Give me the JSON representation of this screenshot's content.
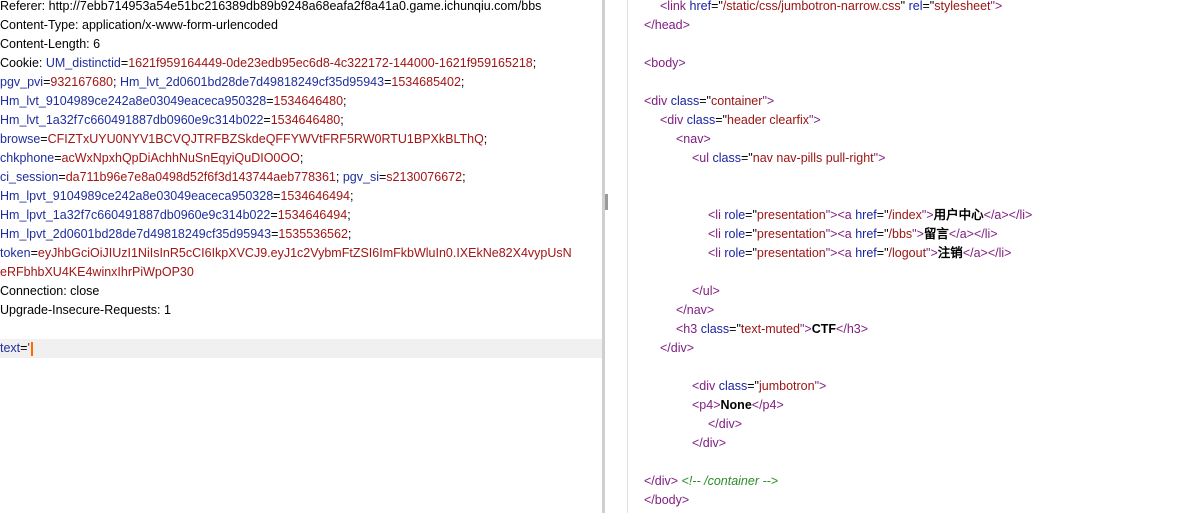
{
  "request": {
    "lines": [
      {
        "parts": [
          {
            "text": "Referer: http://7ebb714953a54e51bc216389db89b9248a68eafa2f8a41a0.game.ichunqiu.com/bbs",
            "c": ""
          }
        ]
      },
      {
        "parts": [
          {
            "text": "Content-Type: application/x-www-form-urlencoded",
            "c": ""
          }
        ]
      },
      {
        "parts": [
          {
            "text": "Content-Length: 6",
            "c": ""
          }
        ]
      },
      {
        "parts": [
          {
            "text": "Cookie: ",
            "c": ""
          },
          {
            "text": "UM_distinctid",
            "c": "k"
          },
          {
            "text": "=",
            "c": ""
          },
          {
            "text": "1621f959164449-0de23edb95ec6d8-4c322172-144000-1621f959165218",
            "c": "v"
          },
          {
            "text": ";",
            "c": ""
          }
        ]
      },
      {
        "parts": [
          {
            "text": "pgv_pvi",
            "c": "k"
          },
          {
            "text": "=",
            "c": ""
          },
          {
            "text": "932167680",
            "c": "v"
          },
          {
            "text": "; ",
            "c": ""
          },
          {
            "text": "Hm_lvt_2d0601bd28de7d49818249cf35d95943",
            "c": "k"
          },
          {
            "text": "=",
            "c": ""
          },
          {
            "text": "1534685402",
            "c": "v"
          },
          {
            "text": ";",
            "c": ""
          }
        ]
      },
      {
        "parts": [
          {
            "text": "Hm_lvt_9104989ce242a8e03049eaceca950328",
            "c": "k"
          },
          {
            "text": "=",
            "c": ""
          },
          {
            "text": "1534646480",
            "c": "v"
          },
          {
            "text": ";",
            "c": ""
          }
        ]
      },
      {
        "parts": [
          {
            "text": "Hm_lvt_1a32f7c660491887db0960e9c314b022",
            "c": "k"
          },
          {
            "text": "=",
            "c": ""
          },
          {
            "text": "1534646480",
            "c": "v"
          },
          {
            "text": ";",
            "c": ""
          }
        ]
      },
      {
        "parts": [
          {
            "text": "browse",
            "c": "k"
          },
          {
            "text": "=",
            "c": ""
          },
          {
            "text": "CFIZTxUYU0NYV1BCVQJTRFBZSkdeQFFYWVtFRF5RW0RTU1BPXkBLThQ",
            "c": "v"
          },
          {
            "text": ";",
            "c": ""
          }
        ]
      },
      {
        "parts": [
          {
            "text": "chkphone",
            "c": "k"
          },
          {
            "text": "=",
            "c": ""
          },
          {
            "text": "acWxNpxhQpDiAchhNuSnEqyiQuDIO0OO",
            "c": "v"
          },
          {
            "text": ";",
            "c": ""
          }
        ]
      },
      {
        "parts": [
          {
            "text": "ci_session",
            "c": "k"
          },
          {
            "text": "=",
            "c": ""
          },
          {
            "text": "da711b96e7e8a0498d52f6f3d143744aeb778361",
            "c": "v"
          },
          {
            "text": "; ",
            "c": ""
          },
          {
            "text": "pgv_si",
            "c": "k"
          },
          {
            "text": "=",
            "c": ""
          },
          {
            "text": "s2130076672",
            "c": "v"
          },
          {
            "text": ";",
            "c": ""
          }
        ]
      },
      {
        "parts": [
          {
            "text": "Hm_lpvt_9104989ce242a8e03049eaceca950328",
            "c": "k"
          },
          {
            "text": "=",
            "c": ""
          },
          {
            "text": "1534646494",
            "c": "v"
          },
          {
            "text": ";",
            "c": ""
          }
        ]
      },
      {
        "parts": [
          {
            "text": "Hm_lpvt_1a32f7c660491887db0960e9c314b022",
            "c": "k"
          },
          {
            "text": "=",
            "c": ""
          },
          {
            "text": "1534646494",
            "c": "v"
          },
          {
            "text": ";",
            "c": ""
          }
        ]
      },
      {
        "parts": [
          {
            "text": "Hm_lpvt_2d0601bd28de7d49818249cf35d95943",
            "c": "k"
          },
          {
            "text": "=",
            "c": ""
          },
          {
            "text": "1535536562",
            "c": "v"
          },
          {
            "text": ";",
            "c": ""
          }
        ]
      },
      {
        "parts": [
          {
            "text": "token",
            "c": "k"
          },
          {
            "text": "=",
            "c": ""
          },
          {
            "text": "eyJhbGciOiJIUzI1NiIsInR5cCI6IkpXVCJ9.eyJ1c2VybmFtZSI6ImFkbWluIn0.IXEkNe82X4vypUsN",
            "c": "v"
          }
        ]
      },
      {
        "parts": [
          {
            "text": "eRFbhbXU4KE4winxIhrPiWpOP30",
            "c": "v"
          }
        ]
      },
      {
        "parts": [
          {
            "text": "Connection: close",
            "c": ""
          }
        ]
      },
      {
        "parts": [
          {
            "text": "Upgrade-Insecure-Requests: 1",
            "c": ""
          }
        ]
      },
      {
        "parts": [
          {
            "text": "",
            "c": ""
          }
        ]
      },
      {
        "parts": [
          {
            "text": "text",
            "c": "k"
          },
          {
            "text": "=",
            "c": ""
          },
          {
            "text": "'",
            "c": "v"
          }
        ],
        "active": true,
        "cursor": true
      }
    ]
  },
  "response": {
    "lines": [
      {
        "indent": 1,
        "parts": [
          {
            "text": "<link ",
            "c": "t"
          },
          {
            "text": "href",
            "c": "a"
          },
          {
            "text": "=\"",
            "c": ""
          },
          {
            "text": "/static/css/jumbotron-narrow.css",
            "c": "s"
          },
          {
            "text": "\" ",
            "c": ""
          },
          {
            "text": "rel",
            "c": "a"
          },
          {
            "text": "=\"",
            "c": ""
          },
          {
            "text": "stylesheet",
            "c": "s"
          },
          {
            "text": "\">",
            "c": "t"
          }
        ]
      },
      {
        "indent": 0,
        "parts": [
          {
            "text": "</head>",
            "c": "t"
          }
        ]
      },
      {
        "indent": 0,
        "parts": []
      },
      {
        "indent": 0,
        "parts": [
          {
            "text": "<body>",
            "c": "t"
          }
        ]
      },
      {
        "indent": 0,
        "parts": []
      },
      {
        "indent": 0,
        "parts": [
          {
            "text": "<div ",
            "c": "t"
          },
          {
            "text": "class",
            "c": "a"
          },
          {
            "text": "=\"",
            "c": ""
          },
          {
            "text": "container",
            "c": "s"
          },
          {
            "text": "\">",
            "c": "t"
          }
        ]
      },
      {
        "indent": 1,
        "parts": [
          {
            "text": "<div ",
            "c": "t"
          },
          {
            "text": "class",
            "c": "a"
          },
          {
            "text": "=\"",
            "c": ""
          },
          {
            "text": "header clearfix",
            "c": "s"
          },
          {
            "text": "\">",
            "c": "t"
          }
        ]
      },
      {
        "indent": 2,
        "parts": [
          {
            "text": "<nav>",
            "c": "t"
          }
        ]
      },
      {
        "indent": 3,
        "parts": [
          {
            "text": "<ul ",
            "c": "t"
          },
          {
            "text": "class",
            "c": "a"
          },
          {
            "text": "=\"",
            "c": ""
          },
          {
            "text": "nav nav-pills pull-right",
            "c": "s"
          },
          {
            "text": "\">",
            "c": "t"
          }
        ]
      },
      {
        "indent": 0,
        "parts": []
      },
      {
        "indent": 0,
        "parts": []
      },
      {
        "indent": 4,
        "parts": [
          {
            "text": "<li ",
            "c": "t"
          },
          {
            "text": "role",
            "c": "a"
          },
          {
            "text": "=\"",
            "c": ""
          },
          {
            "text": "presentation",
            "c": "s"
          },
          {
            "text": "\">",
            "c": "t"
          },
          {
            "text": "<a ",
            "c": "t"
          },
          {
            "text": "href",
            "c": "a"
          },
          {
            "text": "=\"",
            "c": ""
          },
          {
            "text": "/index",
            "c": "s"
          },
          {
            "text": "\">",
            "c": "t"
          },
          {
            "text": "用户中心",
            "c": "bold"
          },
          {
            "text": "</a>",
            "c": "t"
          },
          {
            "text": "</li>",
            "c": "t"
          }
        ]
      },
      {
        "indent": 4,
        "parts": [
          {
            "text": "<li ",
            "c": "t"
          },
          {
            "text": "role",
            "c": "a"
          },
          {
            "text": "=\"",
            "c": ""
          },
          {
            "text": "presentation",
            "c": "s"
          },
          {
            "text": "\">",
            "c": "t"
          },
          {
            "text": "<a ",
            "c": "t"
          },
          {
            "text": "href",
            "c": "a"
          },
          {
            "text": "=\"",
            "c": ""
          },
          {
            "text": "/bbs",
            "c": "s"
          },
          {
            "text": "\">",
            "c": "t"
          },
          {
            "text": "留言",
            "c": "bold"
          },
          {
            "text": "</a>",
            "c": "t"
          },
          {
            "text": "</li>",
            "c": "t"
          }
        ]
      },
      {
        "indent": 4,
        "parts": [
          {
            "text": "<li ",
            "c": "t"
          },
          {
            "text": "role",
            "c": "a"
          },
          {
            "text": "=\"",
            "c": ""
          },
          {
            "text": "presentation",
            "c": "s"
          },
          {
            "text": "\">",
            "c": "t"
          },
          {
            "text": "<a ",
            "c": "t"
          },
          {
            "text": "href",
            "c": "a"
          },
          {
            "text": "=\"",
            "c": ""
          },
          {
            "text": "/logout",
            "c": "s"
          },
          {
            "text": "\">",
            "c": "t"
          },
          {
            "text": "注销",
            "c": "bold"
          },
          {
            "text": "</a>",
            "c": "t"
          },
          {
            "text": "</li>",
            "c": "t"
          }
        ]
      },
      {
        "indent": 0,
        "parts": []
      },
      {
        "indent": 3,
        "parts": [
          {
            "text": "</ul>",
            "c": "t"
          }
        ]
      },
      {
        "indent": 2,
        "parts": [
          {
            "text": "</nav>",
            "c": "t"
          }
        ]
      },
      {
        "indent": 2,
        "parts": [
          {
            "text": "<h3 ",
            "c": "t"
          },
          {
            "text": "class",
            "c": "a"
          },
          {
            "text": "=\"",
            "c": ""
          },
          {
            "text": "text-muted",
            "c": "s"
          },
          {
            "text": "\">",
            "c": "t"
          },
          {
            "text": "CTF",
            "c": "bold"
          },
          {
            "text": "</h3>",
            "c": "t"
          }
        ]
      },
      {
        "indent": 1,
        "parts": [
          {
            "text": "</div>",
            "c": "t"
          }
        ]
      },
      {
        "indent": 0,
        "parts": []
      },
      {
        "indent": 3,
        "parts": [
          {
            "text": "<div ",
            "c": "t"
          },
          {
            "text": "class",
            "c": "a"
          },
          {
            "text": "=\"",
            "c": ""
          },
          {
            "text": "jumbotron",
            "c": "s"
          },
          {
            "text": "\">",
            "c": "t"
          }
        ]
      },
      {
        "indent": 3,
        "parts": [
          {
            "text": "<p4>",
            "c": "t"
          },
          {
            "text": "None",
            "c": "bold"
          },
          {
            "text": "</p4>",
            "c": "t"
          }
        ]
      },
      {
        "indent": 4,
        "parts": [
          {
            "text": "</div>",
            "c": "t"
          }
        ]
      },
      {
        "indent": 3,
        "parts": [
          {
            "text": "</div>",
            "c": "t"
          }
        ]
      },
      {
        "indent": 0,
        "parts": []
      },
      {
        "indent": 0,
        "parts": [
          {
            "text": "</div> ",
            "c": "t"
          },
          {
            "text": "<!-- /container -->",
            "c": "cm"
          }
        ]
      },
      {
        "indent": 0,
        "parts": [
          {
            "text": "</body>",
            "c": "t"
          }
        ]
      }
    ]
  },
  "colors": {
    "header_key": "#1f2e9f",
    "header_value": "#a31515",
    "tag": "#801e80",
    "attribute": "#1a22a3",
    "string": "#9a1212",
    "comment": "#2c8c26",
    "cursor": "#ff6a00",
    "active_line_bg": "#f0f0f0"
  }
}
